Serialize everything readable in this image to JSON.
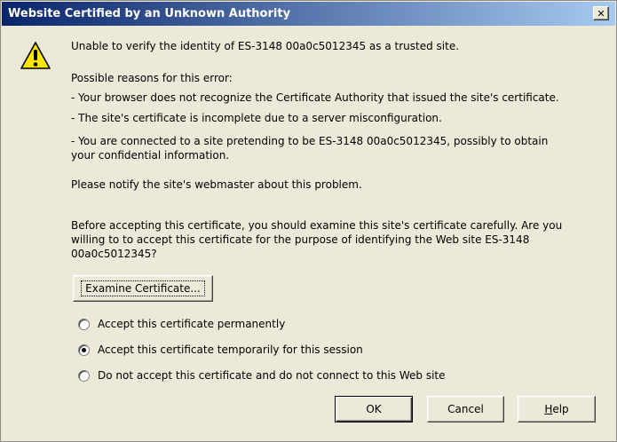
{
  "window": {
    "title": "Website Certified by an Unknown Authority",
    "close_glyph": "✕"
  },
  "icon": "warning-icon",
  "message": {
    "intro": "Unable to verify the identity of ES-3148 00a0c5012345 as a trusted site.",
    "reasons_header": "Possible reasons for this error:",
    "reason_1": "- Your browser does not recognize the Certificate Authority that issued the site's certificate.",
    "reason_2": "- The site's certificate is incomplete due to a server misconfiguration.",
    "reason_3_line1": "- You are connected to a site pretending to be ES-3148 00a0c5012345, possibly to obtain",
    "reason_3_line2": "your confidential information.",
    "notify": "Please notify the site's webmaster about this problem.",
    "advice_line1": "Before accepting this certificate, you should examine this site's certificate carefully. Are you",
    "advice_line2": "willing to to accept this certificate for the purpose of identifying the Web site ES-3148",
    "advice_line3": "00a0c5012345?"
  },
  "examine_button": "Examine Certificate...",
  "options": [
    {
      "label": "Accept this certificate permanently",
      "checked": false
    },
    {
      "label": "Accept this certificate temporarily for this session",
      "checked": true
    },
    {
      "label": "Do not accept this certificate and do not connect to this Web site",
      "checked": false
    }
  ],
  "buttons": {
    "ok": "OK",
    "cancel": "Cancel",
    "help": "Help"
  },
  "colors": {
    "titlebar_start": "#0a246a",
    "titlebar_end": "#a6caf0",
    "face": "#ece9d8",
    "warning_yellow": "#ffe600"
  }
}
